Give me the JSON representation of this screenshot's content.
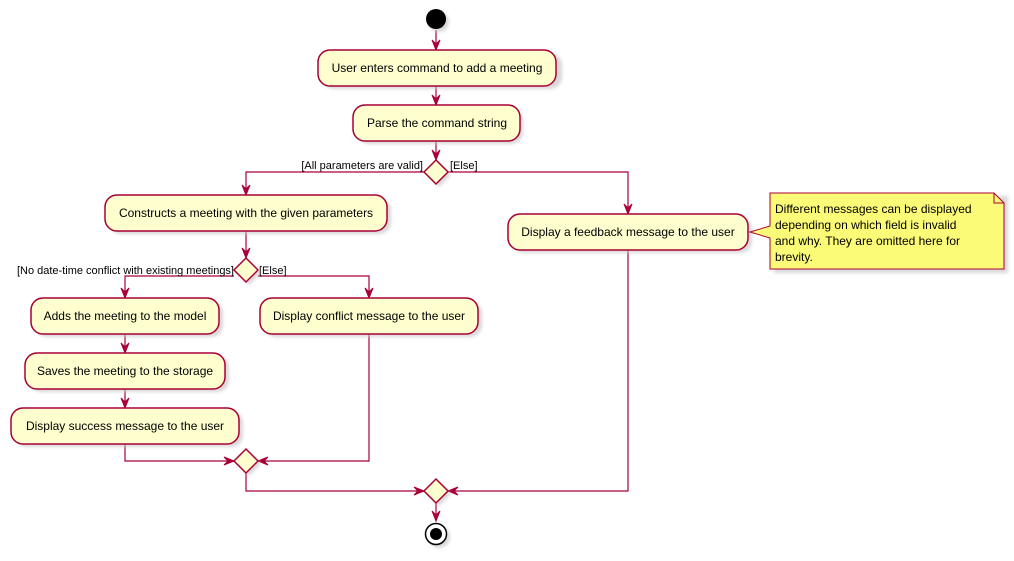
{
  "diagram": {
    "type": "activity",
    "colors": {
      "line": "#A80036",
      "activity_fill": "#FEFECE",
      "note_fill": "#FBFB77",
      "start_node": "#000000"
    },
    "activities": {
      "enter_command": "User enters command to add a meeting",
      "parse": "Parse the command string",
      "construct": "Constructs a meeting with the given parameters",
      "feedback": "Display a feedback message to the user",
      "add_model": "Adds the meeting to the model",
      "conflict": "Display conflict message to the user",
      "save_storage": "Saves the meeting to the storage",
      "success": "Display success message to the user"
    },
    "guards": {
      "valid": "[All parameters are valid]",
      "else1": "[Else]",
      "no_conflict": "[No date-time conflict with existing meetings]",
      "else2": "[Else]"
    },
    "note": {
      "lines": [
        "Different messages can be displayed",
        "depending on which field is invalid",
        "and why. They are omitted here for",
        "brevity."
      ]
    }
  }
}
